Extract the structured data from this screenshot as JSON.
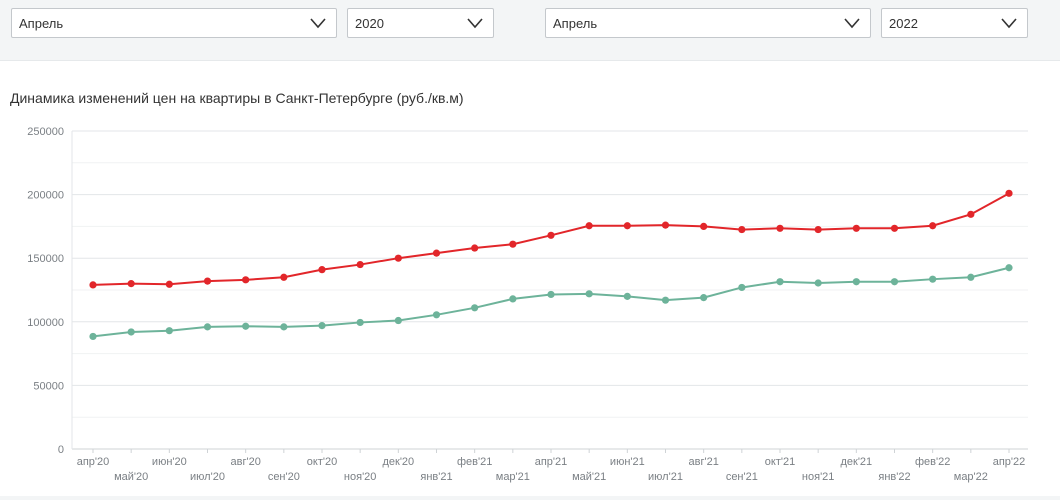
{
  "filters": [
    {
      "value": "Апрель"
    },
    {
      "value": "2020"
    },
    {
      "value": "Апрель"
    },
    {
      "value": "2022"
    }
  ],
  "chart_data": {
    "type": "line",
    "title": "Динамика изменений цен на квартиры в Санкт-Петербурге (руб./кв.м)",
    "x": [
      "апр'20",
      "май'20",
      "июн'20",
      "июл'20",
      "авг'20",
      "сен'20",
      "окт'20",
      "ноя'20",
      "дек'20",
      "янв'21",
      "фев'21",
      "мар'21",
      "апр'21",
      "май'21",
      "июн'21",
      "июл'21",
      "авг'21",
      "сен'21",
      "окт'21",
      "ноя'21",
      "дек'21",
      "янв'22",
      "фев'22",
      "мар'22",
      "апр'22"
    ],
    "series": [
      {
        "color": "#e2262a",
        "values": [
          129000,
          130000,
          129500,
          132000,
          133000,
          135000,
          141000,
          145000,
          150000,
          154000,
          158000,
          161000,
          168000,
          175500,
          175500,
          176000,
          175000,
          172500,
          173500,
          172500,
          173500,
          173500,
          175500,
          184500,
          201000
        ]
      },
      {
        "color": "#6db39a",
        "values": [
          88500,
          92000,
          93000,
          96000,
          96500,
          96000,
          97000,
          99500,
          101000,
          105500,
          111000,
          118000,
          121500,
          122000,
          120000,
          117000,
          119000,
          127000,
          131500,
          130500,
          131500,
          131500,
          133500,
          135000,
          142500
        ]
      }
    ],
    "y_ticks": [
      "250000",
      "200000",
      "150000",
      "100000",
      "50000",
      "0"
    ],
    "ylim": [
      0,
      250000
    ],
    "grid": true,
    "xlabel": "",
    "ylabel": ""
  }
}
